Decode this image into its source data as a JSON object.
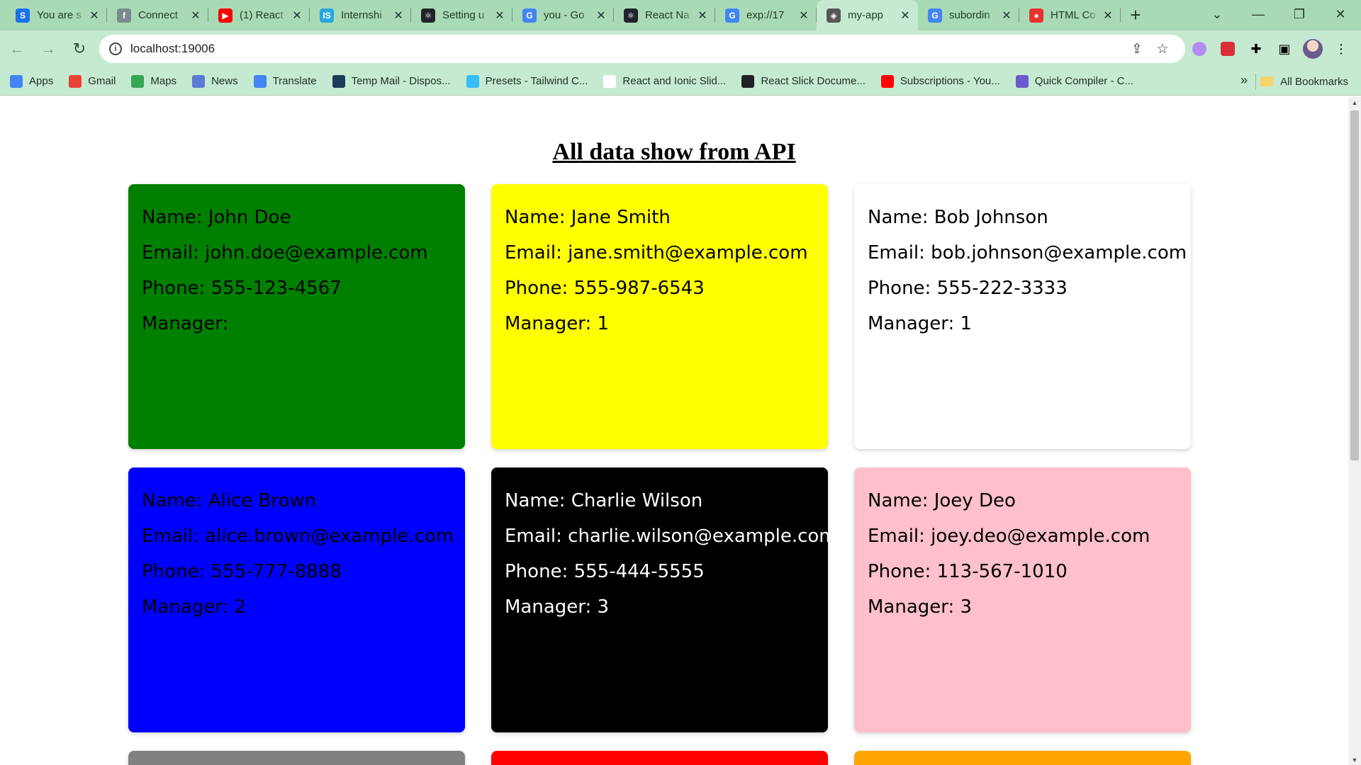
{
  "browser": {
    "tabs": [
      {
        "title": "You are s",
        "favicon": "S",
        "color": "#1a73e8",
        "active": false
      },
      {
        "title": "Connect",
        "favicon": "f",
        "color": "#7b8a8e",
        "active": false
      },
      {
        "title": "(1) React",
        "favicon": "▶",
        "color": "#ff0000",
        "active": false
      },
      {
        "title": "Internshi",
        "favicon": "IS",
        "color": "#2aa7e0",
        "active": false
      },
      {
        "title": "Setting u",
        "favicon": "⚛",
        "color": "#20232a",
        "active": false
      },
      {
        "title": "you - Go",
        "favicon": "G",
        "color": "#4285f4",
        "active": false
      },
      {
        "title": "React Na",
        "favicon": "⚛",
        "color": "#20232a",
        "active": false
      },
      {
        "title": "exp://17",
        "favicon": "G",
        "color": "#4285f4",
        "active": false
      },
      {
        "title": "my-app",
        "favicon": "◈",
        "color": "#555555",
        "active": true
      },
      {
        "title": "subordin",
        "favicon": "G",
        "color": "#4285f4",
        "active": false
      },
      {
        "title": "HTML Co",
        "favicon": "●",
        "color": "#e8322e",
        "active": false
      }
    ],
    "new_tab": "+",
    "url": "localhost:19006",
    "window_controls": {
      "minimize": "—",
      "restore": "❐",
      "close": "✕"
    },
    "bookmarks": [
      {
        "label": "Apps",
        "icon": "apps-grid-icon",
        "color": "#4285f4"
      },
      {
        "label": "Gmail",
        "icon": "gmail-icon",
        "color": "#ea4335"
      },
      {
        "label": "Maps",
        "icon": "maps-pin-icon",
        "color": "#34a853"
      },
      {
        "label": "News",
        "icon": "news-icon",
        "color": "#5b7bd5"
      },
      {
        "label": "Translate",
        "icon": "translate-icon",
        "color": "#4285f4"
      },
      {
        "label": "Temp Mail - Dispos...",
        "icon": "tempmail-icon",
        "color": "#1c3d5a"
      },
      {
        "label": "Presets - Tailwind C...",
        "icon": "tailwind-icon",
        "color": "#38bdf8"
      },
      {
        "label": "React and Ionic Slid...",
        "icon": "slider-icon",
        "color": "#ffffff"
      },
      {
        "label": "React Slick Docume...",
        "icon": "globe-icon",
        "color": "#202124"
      },
      {
        "label": "Subscriptions - You...",
        "icon": "youtube-icon",
        "color": "#ff0000"
      },
      {
        "label": "Quick Compiler - C...",
        "icon": "compiler-icon",
        "color": "#6a5acd"
      }
    ],
    "bookmarks_more": "»",
    "all_bookmarks": "All Bookmarks"
  },
  "page": {
    "heading": "All data show from API",
    "cards": [
      {
        "name": "Name: John Doe",
        "email": "Email: john.doe@example.com",
        "phone": "Phone: 555-123-4567",
        "manager": "Manager:",
        "bg": "#008000",
        "fg": "#000000"
      },
      {
        "name": "Name: Jane Smith",
        "email": "Email: jane.smith@example.com",
        "phone": "Phone: 555-987-6543",
        "manager": "Manager: 1",
        "bg": "#ffff00",
        "fg": "#000000"
      },
      {
        "name": "Name: Bob Johnson",
        "email": "Email: bob.johnson@example.com",
        "phone": "Phone: 555-222-3333",
        "manager": "Manager: 1",
        "bg": "#ffffff",
        "fg": "#000000"
      },
      {
        "name": "Name: Alice Brown",
        "email": "Email: alice.brown@example.com",
        "phone": "Phone: 555-777-8888",
        "manager": "Manager: 2",
        "bg": "#0000ff",
        "fg": "#000000"
      },
      {
        "name": "Name: Charlie Wilson",
        "email": "Email: charlie.wilson@example.com",
        "phone": "Phone: 555-444-5555",
        "manager": "Manager: 3",
        "bg": "#000000",
        "fg": "#ffffff"
      },
      {
        "name": "Name: Joey Deo",
        "email": "Email: joey.deo@example.com",
        "phone": "Phone: 113-567-1010",
        "manager": "Manager: 3",
        "bg": "#ffc0cb",
        "fg": "#000000"
      }
    ],
    "partial_cards": [
      {
        "bg": "#808080"
      },
      {
        "bg": "#ff0000"
      },
      {
        "bg": "#ffa500"
      }
    ]
  }
}
